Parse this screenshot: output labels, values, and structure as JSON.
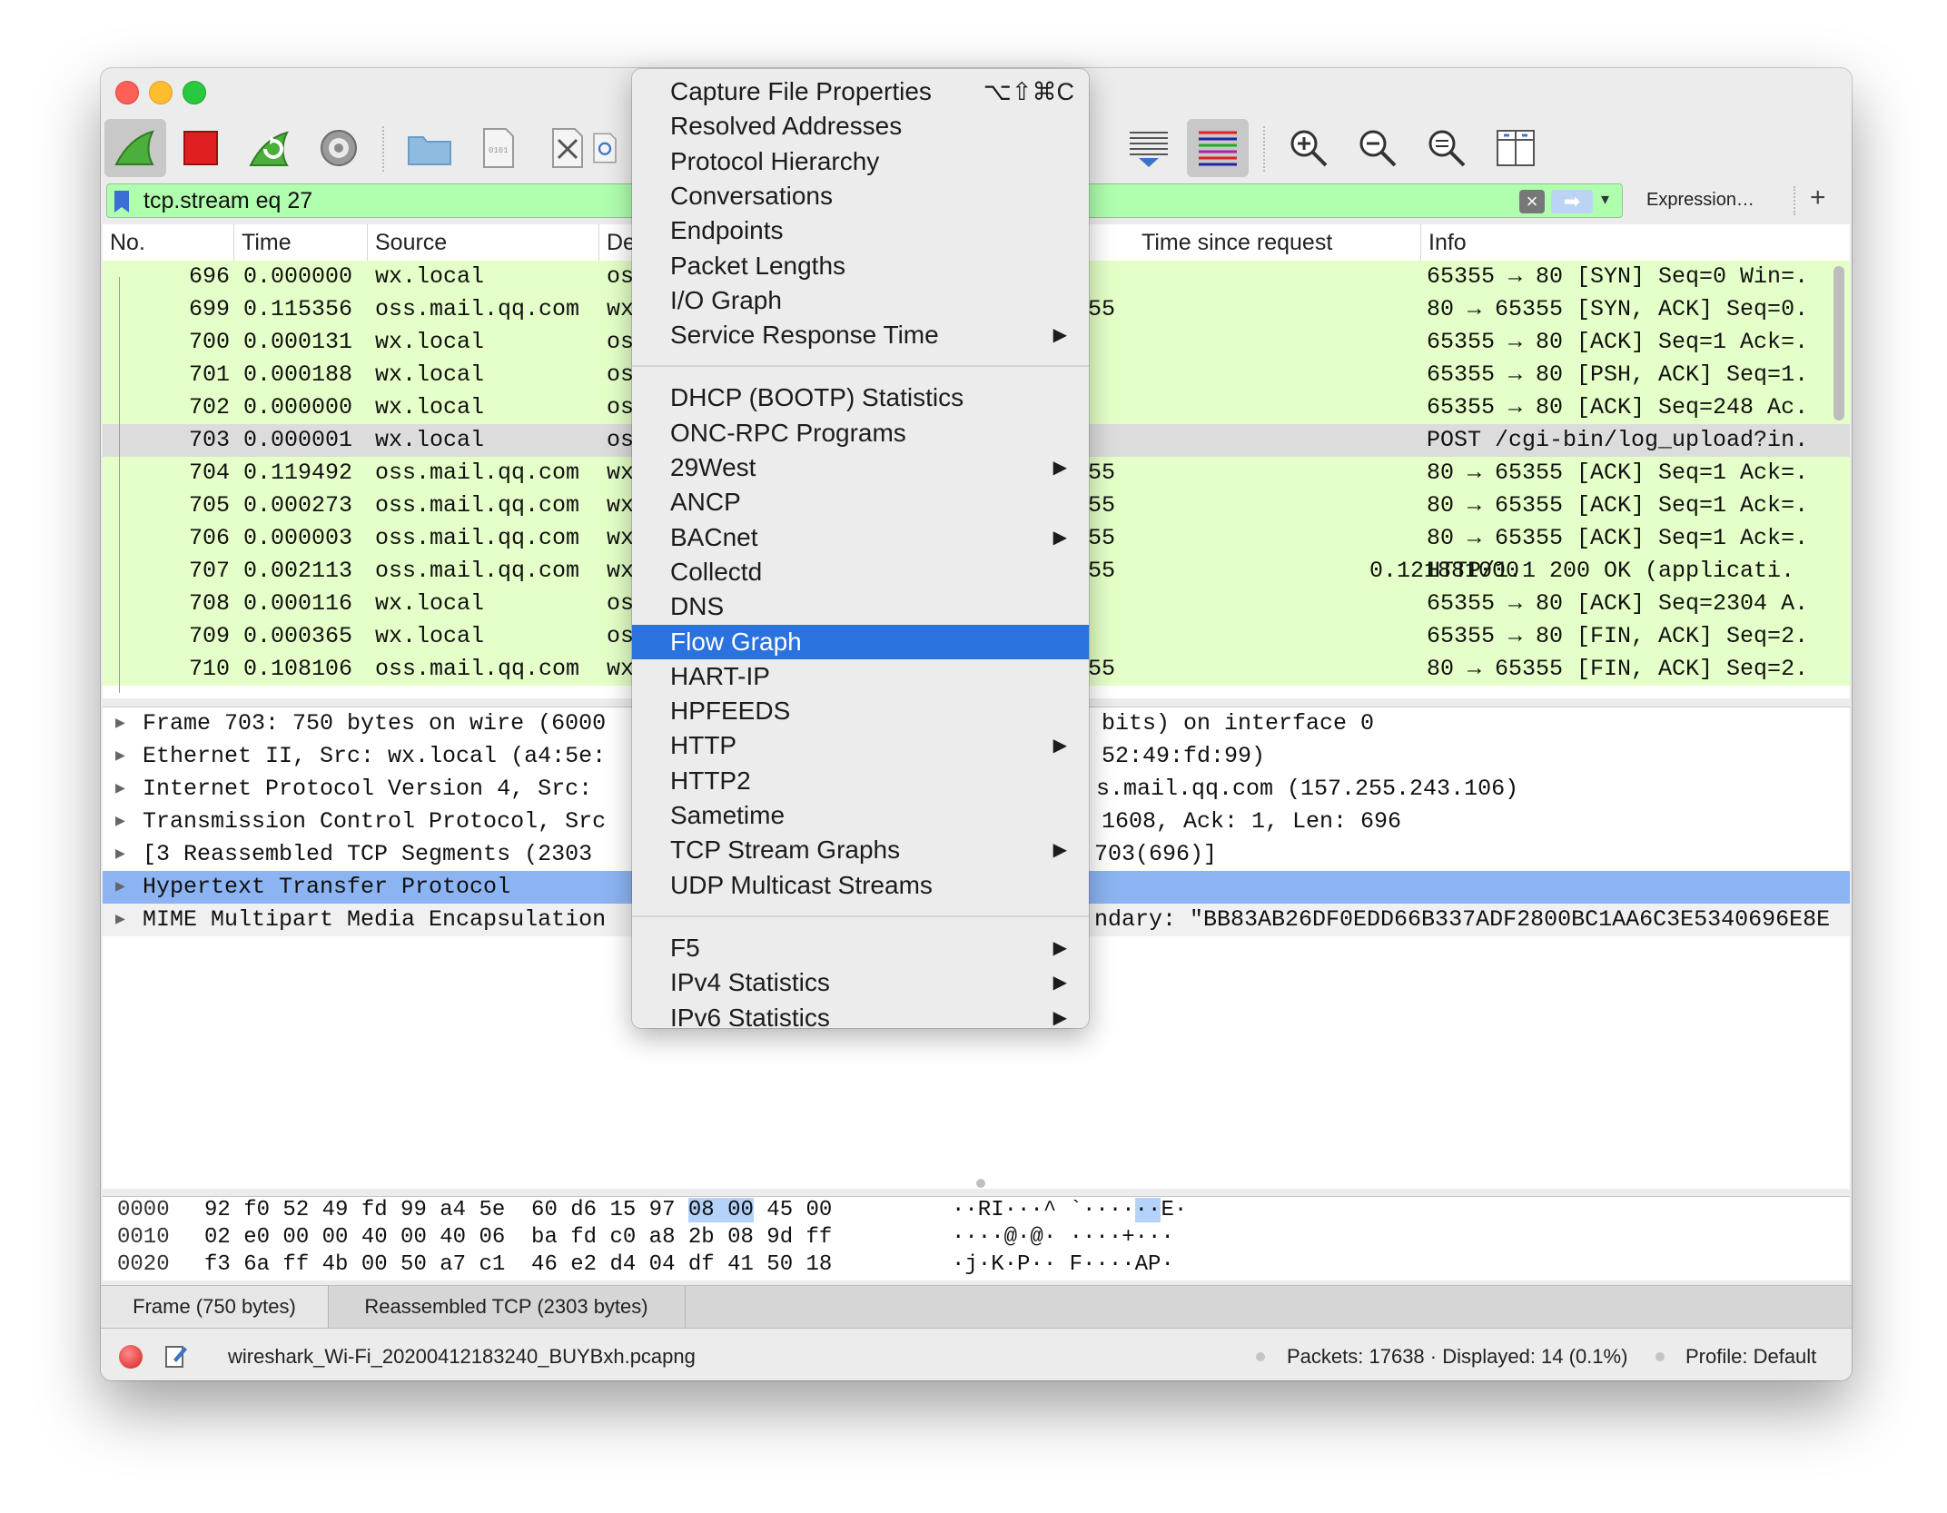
{
  "colors": {
    "filter_green": "#afffaf",
    "row_green": "#e4ffc7",
    "selection_blue": "#2a72dd",
    "detail_selection": "#8cb4f2"
  },
  "toolbar": {
    "icons": [
      "shark-fin-start-icon",
      "stop-capture-icon",
      "restart-capture-icon",
      "capture-options-icon",
      "open-file-icon",
      "save-file-icon",
      "close-file-icon",
      "reload-file-icon",
      "autoscroll-icon",
      "colorize-icon",
      "zoom-in-icon",
      "zoom-out-icon",
      "zoom-normal-icon",
      "resize-columns-icon"
    ]
  },
  "filter": {
    "value": "tcp.stream eq 27",
    "expression_label": "Expression…",
    "add_label": "+"
  },
  "packet_list": {
    "columns": [
      "No.",
      "Time",
      "Source",
      "De",
      "Time since request",
      "Info"
    ],
    "rows": [
      {
        "no": "696",
        "time": "0.000000",
        "src": "wx.local",
        "dst": "os",
        "mid": "",
        "tsr": "",
        "info": "65355 → 80 [SYN] Seq=0 Win=."
      },
      {
        "no": "699",
        "time": "0.115356",
        "src": "oss.mail.qq.com",
        "dst": "wx",
        "mid": "55",
        "tsr": "",
        "info": "80 → 65355 [SYN, ACK] Seq=0."
      },
      {
        "no": "700",
        "time": "0.000131",
        "src": "wx.local",
        "dst": "os",
        "mid": "",
        "tsr": "",
        "info": "65355 → 80 [ACK] Seq=1 Ack=."
      },
      {
        "no": "701",
        "time": "0.000188",
        "src": "wx.local",
        "dst": "os",
        "mid": "",
        "tsr": "",
        "info": "65355 → 80 [PSH, ACK] Seq=1."
      },
      {
        "no": "702",
        "time": "0.000000",
        "src": "wx.local",
        "dst": "os",
        "mid": "",
        "tsr": "",
        "info": "65355 → 80 [ACK] Seq=248 Ac."
      },
      {
        "no": "703",
        "time": "0.000001",
        "src": "wx.local",
        "dst": "os",
        "mid": "",
        "tsr": "",
        "info": "POST /cgi-bin/log_upload?in."
      },
      {
        "no": "704",
        "time": "0.119492",
        "src": "oss.mail.qq.com",
        "dst": "wx",
        "mid": "55",
        "tsr": "",
        "info": "80 → 65355 [ACK] Seq=1 Ack=."
      },
      {
        "no": "705",
        "time": "0.000273",
        "src": "oss.mail.qq.com",
        "dst": "wx",
        "mid": "55",
        "tsr": "",
        "info": "80 → 65355 [ACK] Seq=1 Ack=."
      },
      {
        "no": "706",
        "time": "0.000003",
        "src": "oss.mail.qq.com",
        "dst": "wx",
        "mid": "55",
        "tsr": "",
        "info": "80 → 65355 [ACK] Seq=1 Ack=."
      },
      {
        "no": "707",
        "time": "0.002113",
        "src": "oss.mail.qq.com",
        "dst": "wx",
        "mid": "55",
        "tsr": "0.121881000",
        "info": "HTTP/1.1 200 OK  (applicati."
      },
      {
        "no": "708",
        "time": "0.000116",
        "src": "wx.local",
        "dst": "os",
        "mid": "",
        "tsr": "",
        "info": "65355 → 80 [ACK] Seq=2304 A."
      },
      {
        "no": "709",
        "time": "0.000365",
        "src": "wx.local",
        "dst": "os",
        "mid": "",
        "tsr": "",
        "info": "65355 → 80 [FIN, ACK] Seq=2."
      },
      {
        "no": "710",
        "time": "0.108106",
        "src": "oss.mail.qq.com",
        "dst": "wx",
        "mid": "55",
        "tsr": "",
        "info": "80 → 65355 [FIN, ACK] Seq=2."
      }
    ]
  },
  "details": [
    {
      "left": "Frame 703: 750 bytes on wire (6000",
      "right": "bits) on interface 0"
    },
    {
      "left": "Ethernet II, Src: wx.local (a4:5e:",
      "right": "52:49:fd:99)"
    },
    {
      "left": "Internet Protocol Version 4, Src:",
      "right": "s.mail.qq.com (157.255.243.106)"
    },
    {
      "left": "Transmission Control Protocol, Src",
      "right": "1608, Ack: 1, Len: 696"
    },
    {
      "left": "[3 Reassembled TCP Segments (2303",
      "right": "703(696)]"
    },
    {
      "left": "Hypertext Transfer Protocol",
      "right": ""
    },
    {
      "left": "MIME Multipart Media Encapsulation",
      "right": "ndary: \"BB83AB26DF0EDD66B337ADF2800BC1AA6C3E5340696E8E"
    }
  ],
  "hex": [
    {
      "off": "0000",
      "b1": "92 f0 52 49 fd 99 a4 5e  60 d6 15 97 ",
      "bhl": "08 00",
      "b2": " 45 00",
      "a1": "··RI···^ `····",
      "ahl": "··",
      "a2": "E·"
    },
    {
      "off": "0010",
      "b1": "02 e0 00 00 40 00 40 06  ba fd c0 a8 2b 08 9d ff",
      "bhl": "",
      "b2": "",
      "a1": "····@·@· ····+···",
      "ahl": "",
      "a2": ""
    },
    {
      "off": "0020",
      "b1": "f3 6a ff 4b 00 50 a7 c1  46 e2 d4 04 df 41 50 18",
      "bhl": "",
      "b2": "",
      "a1": "·j·K·P·· F····AP·",
      "ahl": "",
      "a2": ""
    }
  ],
  "byte_tabs": [
    "Frame (750 bytes)",
    "Reassembled TCP (2303 bytes)"
  ],
  "status": {
    "filename": "wireshark_Wi-Fi_20200412183240_BUYBxh.pcapng",
    "packets": "Packets: 17638 · Displayed: 14 (0.1%)",
    "profile": "Profile: Default"
  },
  "menu": {
    "group1": [
      {
        "label": "Capture File Properties",
        "shortcut": "⌥⇧⌘C",
        "submenu": false
      },
      {
        "label": "Resolved Addresses",
        "shortcut": "",
        "submenu": false
      },
      {
        "label": "Protocol Hierarchy",
        "shortcut": "",
        "submenu": false
      },
      {
        "label": "Conversations",
        "shortcut": "",
        "submenu": false
      },
      {
        "label": "Endpoints",
        "shortcut": "",
        "submenu": false
      },
      {
        "label": "Packet Lengths",
        "shortcut": "",
        "submenu": false
      },
      {
        "label": "I/O Graph",
        "shortcut": "",
        "submenu": false
      },
      {
        "label": "Service Response Time",
        "shortcut": "",
        "submenu": true
      }
    ],
    "group2": [
      {
        "label": "DHCP (BOOTP) Statistics",
        "submenu": false
      },
      {
        "label": "ONC-RPC Programs",
        "submenu": false
      },
      {
        "label": "29West",
        "submenu": true
      },
      {
        "label": "ANCP",
        "submenu": false
      },
      {
        "label": "BACnet",
        "submenu": true
      },
      {
        "label": "Collectd",
        "submenu": false
      },
      {
        "label": "DNS",
        "submenu": false
      },
      {
        "label": "Flow Graph",
        "submenu": false,
        "selected": true
      },
      {
        "label": "HART-IP",
        "submenu": false
      },
      {
        "label": "HPFEEDS",
        "submenu": false
      },
      {
        "label": "HTTP",
        "submenu": true
      },
      {
        "label": "HTTP2",
        "submenu": false
      },
      {
        "label": "Sametime",
        "submenu": false
      },
      {
        "label": "TCP Stream Graphs",
        "submenu": true
      },
      {
        "label": "UDP Multicast Streams",
        "submenu": false
      }
    ],
    "group3": [
      {
        "label": "F5",
        "submenu": true
      },
      {
        "label": "IPv4 Statistics",
        "submenu": true
      },
      {
        "label": "IPv6 Statistics",
        "submenu": true
      }
    ]
  }
}
